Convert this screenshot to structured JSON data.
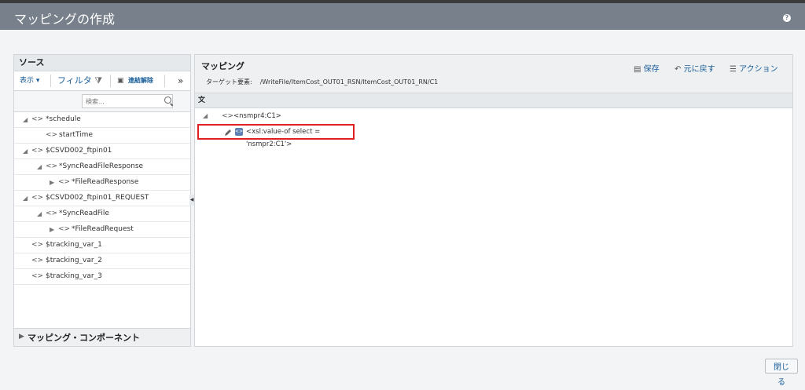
{
  "window": {
    "title": "マッピングの作成",
    "help_glyph": "?"
  },
  "source": {
    "title": "ソース",
    "toolbar": {
      "view": "表示 ▾",
      "filter": "フィルタ",
      "disconnect": "連結解除",
      "more": "»"
    },
    "search_placeholder": "検索...",
    "tree": [
      {
        "expander": "◢",
        "label": "*schedule"
      },
      {
        "expander": "",
        "label": "startTime"
      },
      {
        "expander": "◢",
        "label": "$CSVD002_ftpin01"
      },
      {
        "expander": "◢",
        "label": "*SyncReadFileResponse"
      },
      {
        "expander": "▶",
        "label": "*FileReadResponse"
      },
      {
        "expander": "◢",
        "label": "$CSVD002_ftpin01_REQUEST"
      },
      {
        "expander": "◢",
        "label": "*SyncReadFile"
      },
      {
        "expander": "▶",
        "label": "*FileReadRequest"
      },
      {
        "expander": "",
        "label": "$tracking_var_1"
      },
      {
        "expander": "",
        "label": "$tracking_var_2"
      },
      {
        "expander": "",
        "label": "$tracking_var_3"
      }
    ],
    "footer": "マッピング・コンポーネント"
  },
  "mapping": {
    "title": "マッピング",
    "target_label": "ターゲット要素:",
    "target_path": "/WriteFile/ItemCost_OUT01_RSN/ItemCost_OUT01_RN/C1",
    "actions": {
      "save": "保存",
      "undo": "元に戻す",
      "action": "アクション"
    },
    "column": "文",
    "node": "<nsmpr4:C1>",
    "statement": "<xsl:value-of select = 'nsmpr2:C1'>"
  },
  "close_button": "閉じる"
}
